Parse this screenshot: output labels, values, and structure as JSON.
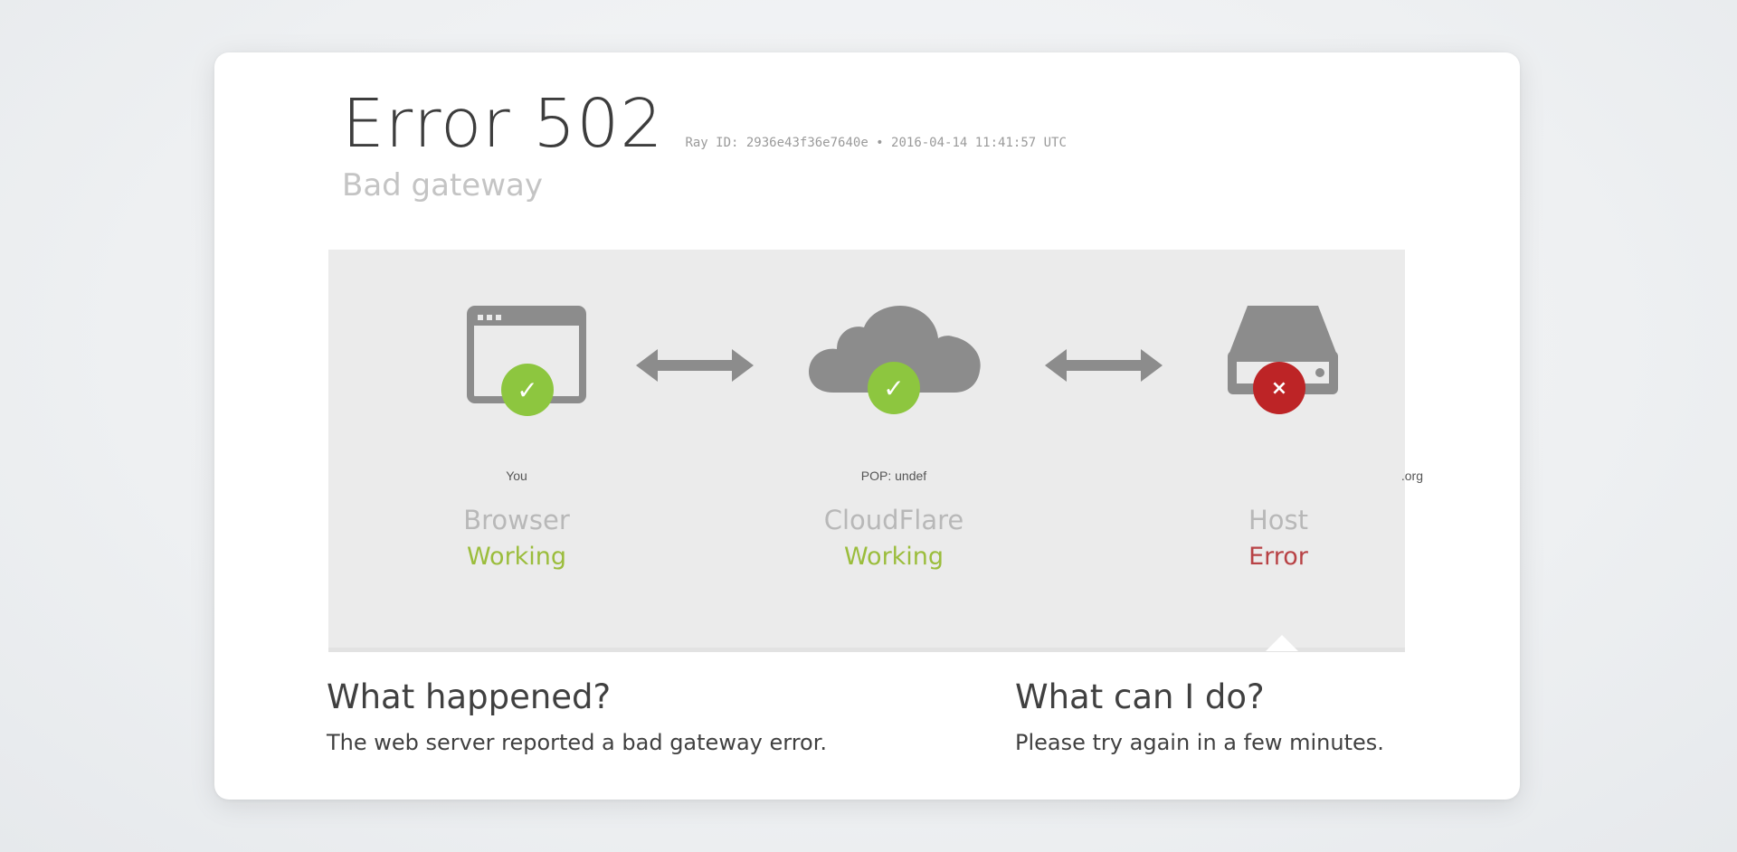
{
  "header": {
    "title": "Error 502",
    "ray_meta": "Ray ID: 2936e43f36e7640e • 2016-04-14 11:41:57 UTC",
    "subtitle": "Bad gateway"
  },
  "diagram": {
    "nodes": [
      {
        "location": "You",
        "name": "Browser",
        "status": "Working",
        "icon": "browser-window-icon",
        "badge": "check-icon"
      },
      {
        "location": "POP: undef",
        "name": "CloudFlare",
        "status": "Working",
        "icon": "cloud-icon",
        "badge": "check-icon"
      },
      {
        "location": ".org",
        "name": "Host",
        "status": "Error",
        "icon": "server-drive-icon",
        "badge": "x-icon"
      }
    ],
    "badge_symbols": {
      "ok": "✓",
      "error": "×"
    }
  },
  "info": {
    "what_happened": {
      "title": "What happened?",
      "text": "The web server reported a bad gateway error."
    },
    "what_can_i_do": {
      "title": "What can I do?",
      "text": "Please try again in a few minutes."
    }
  },
  "colors": {
    "ok": "#8dc63f",
    "error": "#bd2426",
    "icon_gray": "#8c8c8c",
    "panel": "#ebebeb"
  }
}
